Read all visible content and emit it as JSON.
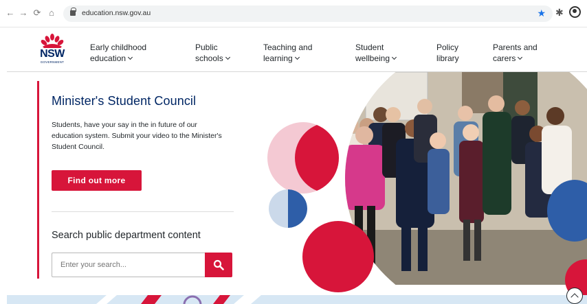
{
  "browser": {
    "url": "education.nsw.gov.au"
  },
  "header": {
    "logo_text": "NSW",
    "logo_sub": "GOVERNMENT",
    "nav": [
      {
        "line1": "Early childhood",
        "line2": "education",
        "dropdown": true
      },
      {
        "line1": "Public",
        "line2": "schools",
        "dropdown": true
      },
      {
        "line1": "Teaching and",
        "line2": "learning",
        "dropdown": true
      },
      {
        "line1": "Student",
        "line2": "wellbeing",
        "dropdown": true
      },
      {
        "line1": "Policy",
        "line2": "library",
        "dropdown": false
      },
      {
        "line1": "Parents and",
        "line2": "carers",
        "dropdown": true
      }
    ]
  },
  "hero": {
    "title": "Minister's Student Council",
    "text": "Students, have your say in the in future of our education system. Submit your video to the Minister's Student Council.",
    "cta_label": "Find out more"
  },
  "search": {
    "heading": "Search public department content",
    "placeholder": "Enter your search..."
  },
  "colors": {
    "brand_red": "#d7153a",
    "brand_navy": "#002664",
    "light_pink": "#f4c9d3",
    "light_blue": "#cbd9ea",
    "mid_blue": "#2e5ea8"
  }
}
